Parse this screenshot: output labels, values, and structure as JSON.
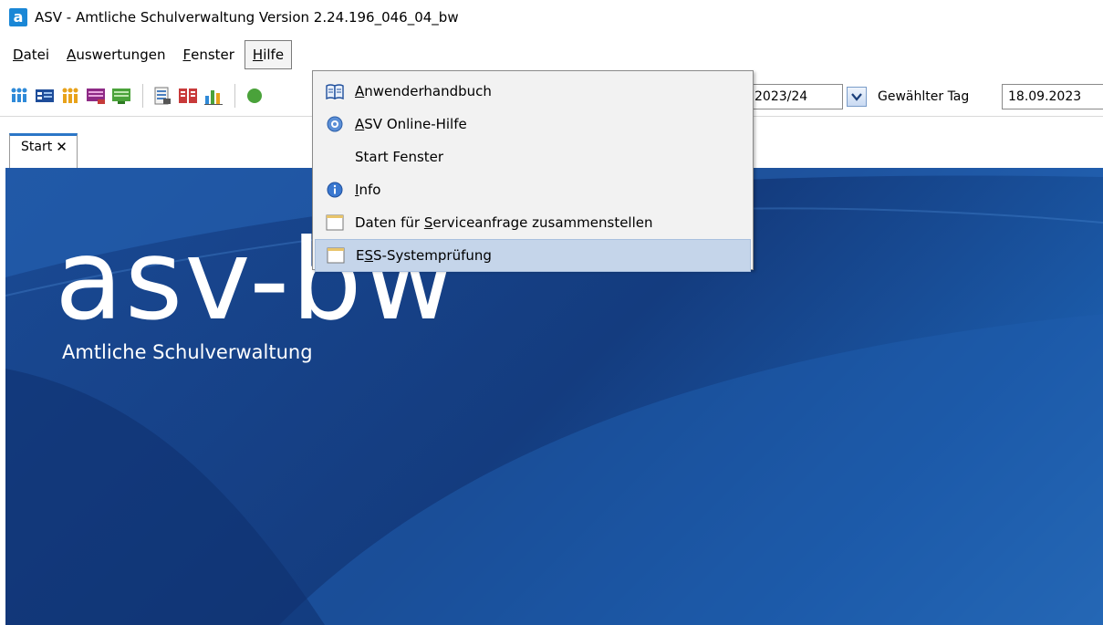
{
  "window": {
    "title": "ASV - Amtliche Schulverwaltung Version 2.24.196_046_04_bw",
    "icon_letter": "a"
  },
  "menubar": {
    "items": [
      {
        "pre": "",
        "accel": "D",
        "rest": "atei"
      },
      {
        "pre": "",
        "accel": "A",
        "rest": "uswertungen"
      },
      {
        "pre": "",
        "accel": "F",
        "rest": "enster"
      },
      {
        "pre": "",
        "accel": "H",
        "rest": "ilfe"
      }
    ]
  },
  "toolbar": {
    "school_year": "2023/24",
    "day_label": "Gewählter Tag",
    "day_value": "18.09.2023"
  },
  "tabs": [
    {
      "label": "Start",
      "close": "✕"
    }
  ],
  "splash": {
    "logo": "asv-bw",
    "subtitle": "Amtliche Schulverwaltung"
  },
  "hilfe_menu": {
    "items": [
      {
        "pre": "",
        "accel": "A",
        "rest": "nwenderhandbuch",
        "icon": "book-icon"
      },
      {
        "pre": "",
        "accel": "A",
        "rest": "SV Online-Hilfe",
        "icon": "help-icon"
      },
      {
        "pre": "Start Fenster",
        "accel": "",
        "rest": "",
        "icon": ""
      },
      {
        "pre": "",
        "accel": "I",
        "rest": "nfo",
        "icon": "info-icon"
      },
      {
        "pre": "Daten für ",
        "accel": "S",
        "rest": "erviceanfrage zusammenstellen",
        "icon": "window-icon"
      },
      {
        "pre": "E",
        "accel": "S",
        "rest": "S-Systemprüfung",
        "icon": "window-icon"
      }
    ]
  },
  "colors": {
    "accent": "#2b77c7",
    "menu_hover": "#c5d5ea",
    "splash_bg": "#17438a"
  }
}
